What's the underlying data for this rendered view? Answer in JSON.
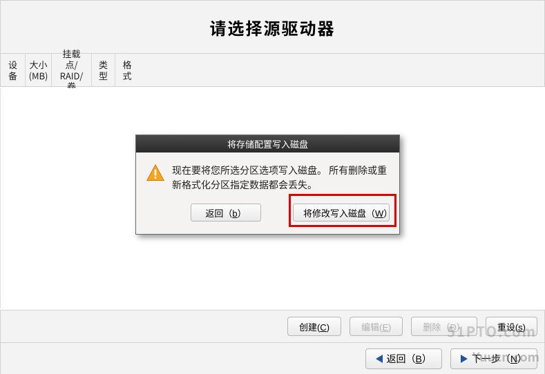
{
  "header": {
    "title": "请选择源驱动器"
  },
  "columns": [
    "设备",
    "大小\n(MB)",
    "挂载点/\nRAID/卷",
    "类型",
    "格式"
  ],
  "dialog": {
    "title": "将存储配置写入磁盘",
    "message": "现在要将您所选分区选项写入磁盘。 所有删除或重新格式化分区指定数据都会丢失。",
    "back_pre": "返回（",
    "back_key": "b",
    "back_post": "）",
    "write_pre": "将修改写入磁盘（",
    "write_key": "W",
    "write_post": "）"
  },
  "toolbar": {
    "create_pre": "创建(",
    "create_key": "C",
    "create_post": ")",
    "edit_pre": "编辑(",
    "edit_key": "E",
    "edit_post": ")",
    "delete_pre": "删除（",
    "delete_key": "D",
    "delete_post": "）",
    "reset_pre": "重设(",
    "reset_key": "s",
    "reset_post": ")"
  },
  "footer": {
    "back_pre": "返回（",
    "back_key": "B",
    "back_post": "）",
    "next_pre": "下一步（",
    "next_key": "N",
    "next_post": "）"
  },
  "watermarks": {
    "w1": "51PTO.com",
    "w2": "Yuucn.com"
  }
}
